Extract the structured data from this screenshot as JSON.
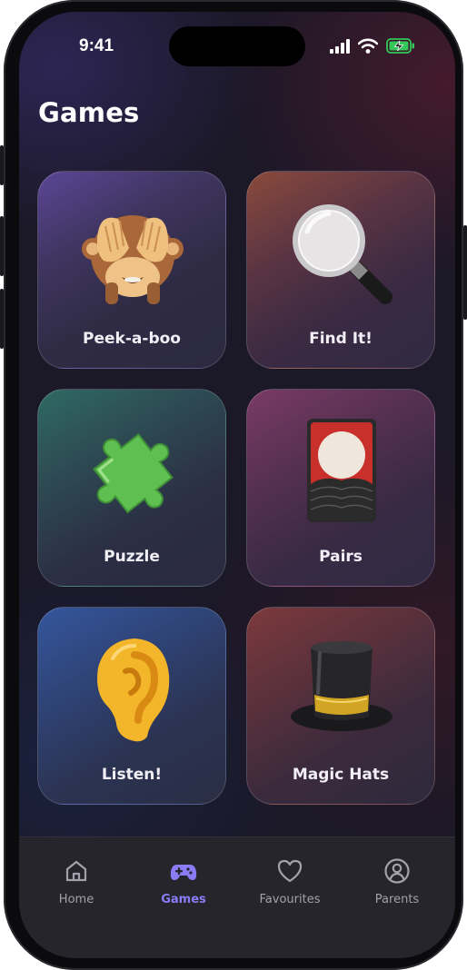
{
  "status_bar": {
    "time": "9:41"
  },
  "page": {
    "title": "Games"
  },
  "games": [
    {
      "label": "Peek-a-boo",
      "icon": "see-no-evil-monkey-icon"
    },
    {
      "label": "Find It!",
      "icon": "magnifying-glass-icon"
    },
    {
      "label": "Puzzle",
      "icon": "puzzle-piece-icon"
    },
    {
      "label": "Pairs",
      "icon": "flower-playing-card-icon"
    },
    {
      "label": "Listen!",
      "icon": "ear-icon"
    },
    {
      "label": "Magic Hats",
      "icon": "top-hat-icon"
    }
  ],
  "tabbar": {
    "items": [
      {
        "label": "Home",
        "icon": "home-icon",
        "active": false
      },
      {
        "label": "Games",
        "icon": "gamepad-icon",
        "active": true
      },
      {
        "label": "Favourites",
        "icon": "heart-icon",
        "active": false
      },
      {
        "label": "Parents",
        "icon": "user-circle-icon",
        "active": false
      }
    ]
  },
  "colors": {
    "accent": "#8b7cf6",
    "background": "#1b1827",
    "tabbar": "#25252b",
    "battery": "#34c759"
  }
}
